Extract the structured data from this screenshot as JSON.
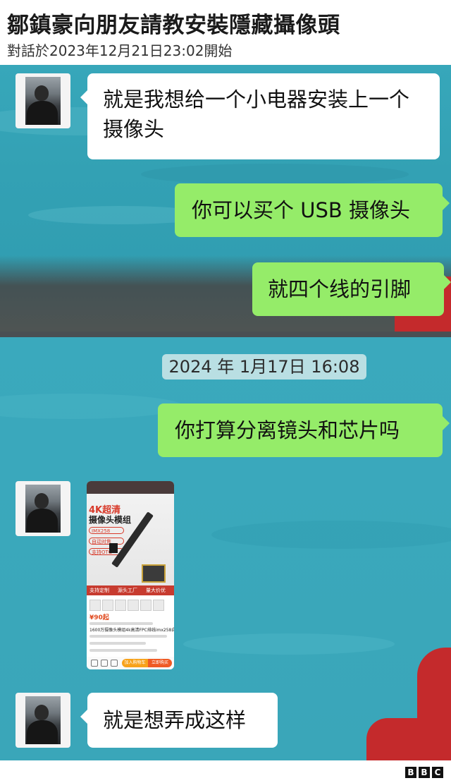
{
  "header": {
    "title": "鄒鎮豪向朋友請教安裝隱藏攝像頭",
    "subtitle": "對話於2023年12月21日23:02開始"
  },
  "chat_part1": {
    "messages": [
      {
        "side": "left",
        "text": "就是我想给一个小电器安装上一个摄像头"
      },
      {
        "side": "right",
        "text": "你可以买个 USB 摄像头"
      },
      {
        "side": "right",
        "text": "就四个线的引脚"
      }
    ]
  },
  "chat_part2": {
    "timestamp": "2024 年 1月17日 16:08",
    "messages": [
      {
        "side": "right",
        "text": "你打算分离镜头和芯片吗"
      },
      {
        "side": "left",
        "type": "image"
      },
      {
        "side": "left",
        "text": "就是想弄成这样"
      }
    ]
  },
  "product_image": {
    "headline": "4K超清",
    "subheadline": "摄像头模组",
    "tags": [
      "IMX258",
      "自动对焦",
      "支持OTG"
    ],
    "bar_labels": [
      "支持定制",
      "源头工厂",
      "量大价优"
    ],
    "price": "¥90起",
    "title_text": "1600万摄像头模组4k高清FPC排线imx258自",
    "buttons": [
      "加入购物车",
      "立即购买"
    ]
  },
  "footer": {
    "logo_letters": [
      "B",
      "B",
      "C"
    ]
  },
  "colors": {
    "green_bubble": "#95ec69",
    "white_bubble": "#ffffff",
    "background_teal": "#35a5b8"
  }
}
